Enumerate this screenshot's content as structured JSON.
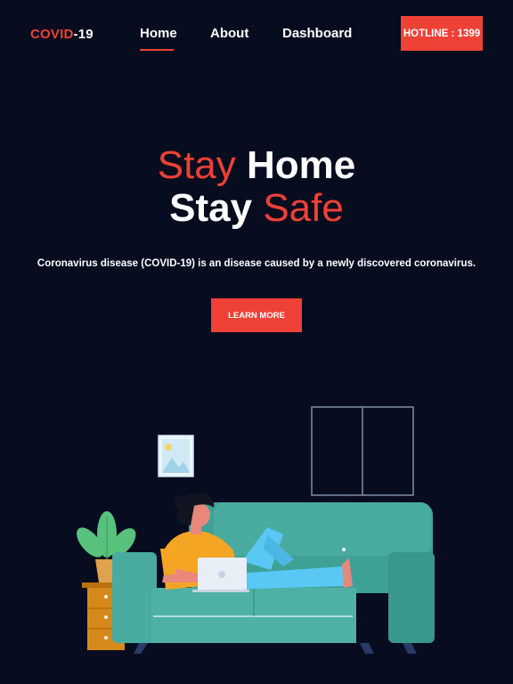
{
  "nav": {
    "logo_prefix": "COVID",
    "logo_suffix": "-19",
    "links": [
      "Home",
      "About",
      "Dashboard"
    ],
    "active": "Home",
    "hotline_label": "HOTLINE : 1399"
  },
  "hero": {
    "line1_word1": "Stay",
    "line1_word2": "Home",
    "line2_word1": "Stay",
    "line2_word2": "Safe",
    "subtitle": "Coronavirus disease (COVID-19) is an disease caused by a newly discovered coronavirus.",
    "cta_label": "LEARN MORE"
  },
  "colors": {
    "background": "#070c1f",
    "accent": "#ef4136",
    "sofa": "#49aaa0",
    "shirt": "#f5a524",
    "pants": "#5ac8f5"
  },
  "icons": [
    "window-icon",
    "picture-frame-icon",
    "plant-icon",
    "laptop-icon"
  ]
}
